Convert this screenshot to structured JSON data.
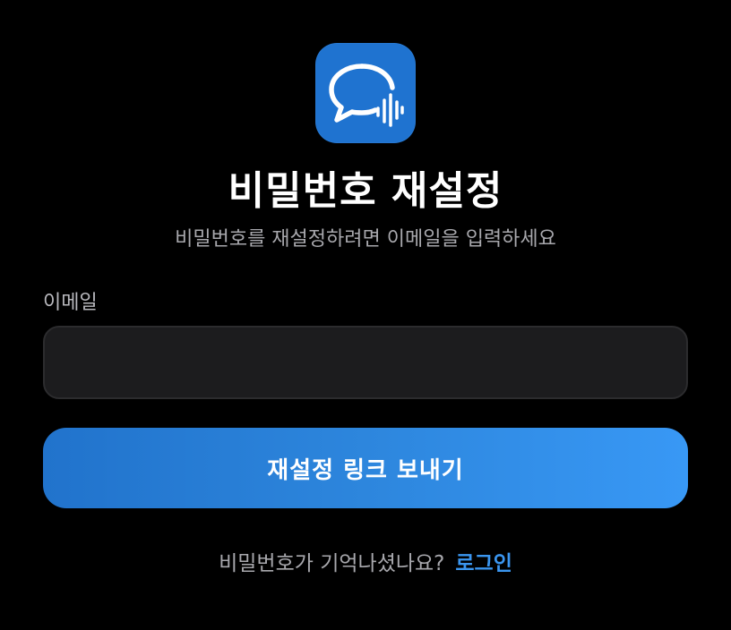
{
  "app": {
    "icon": "chat-bubble-waveform-icon",
    "icon_color": "#1f73d0"
  },
  "header": {
    "title": "비밀번호 재설정",
    "subtitle": "비밀번호를 재설정하려면 이메일을 입력하세요"
  },
  "form": {
    "email_label": "이메일",
    "email_value": "",
    "email_placeholder": "",
    "submit_label": "재설정 링크 보내기"
  },
  "footer": {
    "prompt": "비밀번호가 기억나셨나요?",
    "login_label": "로그인"
  },
  "colors": {
    "background": "#000000",
    "accent": "#2d86dd",
    "link": "#3b96f0",
    "input_background": "#1c1c1e"
  }
}
